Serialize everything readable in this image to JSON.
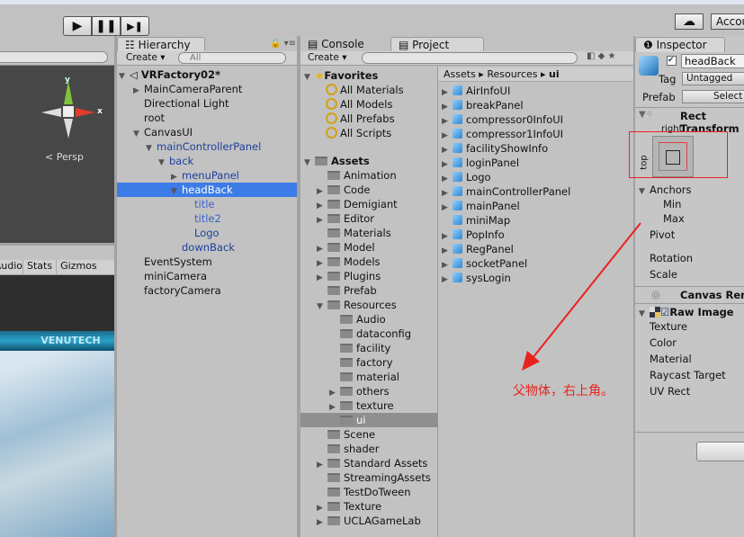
{
  "toolbar": {
    "play": "▶",
    "pause": "❚❚",
    "step": "▶❚",
    "cloud": "☁",
    "account": "Account"
  },
  "scene": {
    "persp": "< Persp",
    "axis_x": "x",
    "axis_y": "y"
  },
  "game": {
    "tabs": [
      "Audio",
      "Stats",
      "Gizmos"
    ],
    "banner": "VENUTECH"
  },
  "hierarchy": {
    "tab": "Hierarchy",
    "create": "Create",
    "search": "All",
    "rows": [
      {
        "label": "VRFactory02*",
        "indent": 0,
        "bold": true
      },
      {
        "label": "MainCameraParent",
        "indent": 1,
        "arrow": "▶"
      },
      {
        "label": "Directional Light",
        "indent": 1
      },
      {
        "label": "root",
        "indent": 1
      },
      {
        "label": "CanvasUI",
        "indent": 1,
        "arrow": "▼"
      },
      {
        "label": "mainControllerPanel",
        "indent": 2,
        "arrow": "▼",
        "blue": true
      },
      {
        "label": "back",
        "indent": 3,
        "arrow": "▼",
        "blue": true
      },
      {
        "label": "menuPanel",
        "indent": 4,
        "arrow": "▶",
        "blue": true
      },
      {
        "label": "headBack",
        "indent": 4,
        "arrow": "▼",
        "selected": true
      },
      {
        "label": "title",
        "indent": 5,
        "blue": true,
        "faded": true
      },
      {
        "label": "title2",
        "indent": 5,
        "blue": true,
        "faded": true
      },
      {
        "label": "Logo",
        "indent": 5,
        "blue": true
      },
      {
        "label": "downBack",
        "indent": 4,
        "blue": true
      },
      {
        "label": "EventSystem",
        "indent": 1
      },
      {
        "label": "miniCamera",
        "indent": 1
      },
      {
        "label": "factoryCamera",
        "indent": 1
      }
    ]
  },
  "console": {
    "tab": "Console"
  },
  "project": {
    "tab": "Project",
    "create": "Create",
    "favorites": {
      "label": "Favorites",
      "items": [
        "All Materials",
        "All Models",
        "All Prefabs",
        "All Scripts"
      ]
    },
    "assets": {
      "label": "Assets",
      "items": [
        {
          "label": "Animation",
          "indent": 1
        },
        {
          "label": "Code",
          "indent": 1,
          "arrow": "▶"
        },
        {
          "label": "Demigiant",
          "indent": 1,
          "arrow": "▶"
        },
        {
          "label": "Editor",
          "indent": 1,
          "arrow": "▶"
        },
        {
          "label": "Materials",
          "indent": 1
        },
        {
          "label": "Model",
          "indent": 1,
          "arrow": "▶"
        },
        {
          "label": "Models",
          "indent": 1,
          "arrow": "▶"
        },
        {
          "label": "Plugins",
          "indent": 1,
          "arrow": "▶"
        },
        {
          "label": "Prefab",
          "indent": 1
        },
        {
          "label": "Resources",
          "indent": 1,
          "arrow": "▼"
        },
        {
          "label": "Audio",
          "indent": 2
        },
        {
          "label": "dataconfig",
          "indent": 2
        },
        {
          "label": "facility",
          "indent": 2
        },
        {
          "label": "factory",
          "indent": 2
        },
        {
          "label": "material",
          "indent": 2
        },
        {
          "label": "others",
          "indent": 2,
          "arrow": "▶"
        },
        {
          "label": "texture",
          "indent": 2,
          "arrow": "▶"
        },
        {
          "label": "ui",
          "indent": 2,
          "selected": true
        },
        {
          "label": "Scene",
          "indent": 1
        },
        {
          "label": "shader",
          "indent": 1
        },
        {
          "label": "Standard Assets",
          "indent": 1,
          "arrow": "▶"
        },
        {
          "label": "StreamingAssets",
          "indent": 1
        },
        {
          "label": "TestDoTween",
          "indent": 1
        },
        {
          "label": "Texture",
          "indent": 1,
          "arrow": "▶"
        },
        {
          "label": "UCLAGameLab",
          "indent": 1,
          "arrow": "▶"
        }
      ]
    },
    "breadcrumb": [
      "Assets",
      "Resources",
      "ui"
    ],
    "files": [
      "AirInfoUI",
      "breakPanel",
      "compressor0InfoUI",
      "compressor1InfoUI",
      "facilityShowInfo",
      "loginPanel",
      "Logo",
      "mainControllerPanel",
      "mainPanel",
      "miniMap",
      "PopInfo",
      "RegPanel",
      "socketPanel",
      "sysLogin"
    ]
  },
  "inspector": {
    "tab": "Inspector",
    "name": "headBack",
    "tag_label": "Tag",
    "tag": "Untagged",
    "prefab_label": "Prefab",
    "select": "Select",
    "rect_transform": "Rect Transform",
    "anchor_h": "right",
    "anchor_v": "top",
    "anchors": "Anchors",
    "min": "Min",
    "max": "Max",
    "pivot": "Pivot",
    "rotation": "Rotation",
    "scale": "Scale",
    "canvas_renderer": "Canvas Renderer",
    "raw_image": "Raw Image",
    "raw_fields": [
      "Texture",
      "Color",
      "Material",
      "Raycast Target",
      "UV Rect"
    ]
  },
  "annotation": {
    "text": "父物体，右上角。",
    "color": "#e8231f"
  }
}
